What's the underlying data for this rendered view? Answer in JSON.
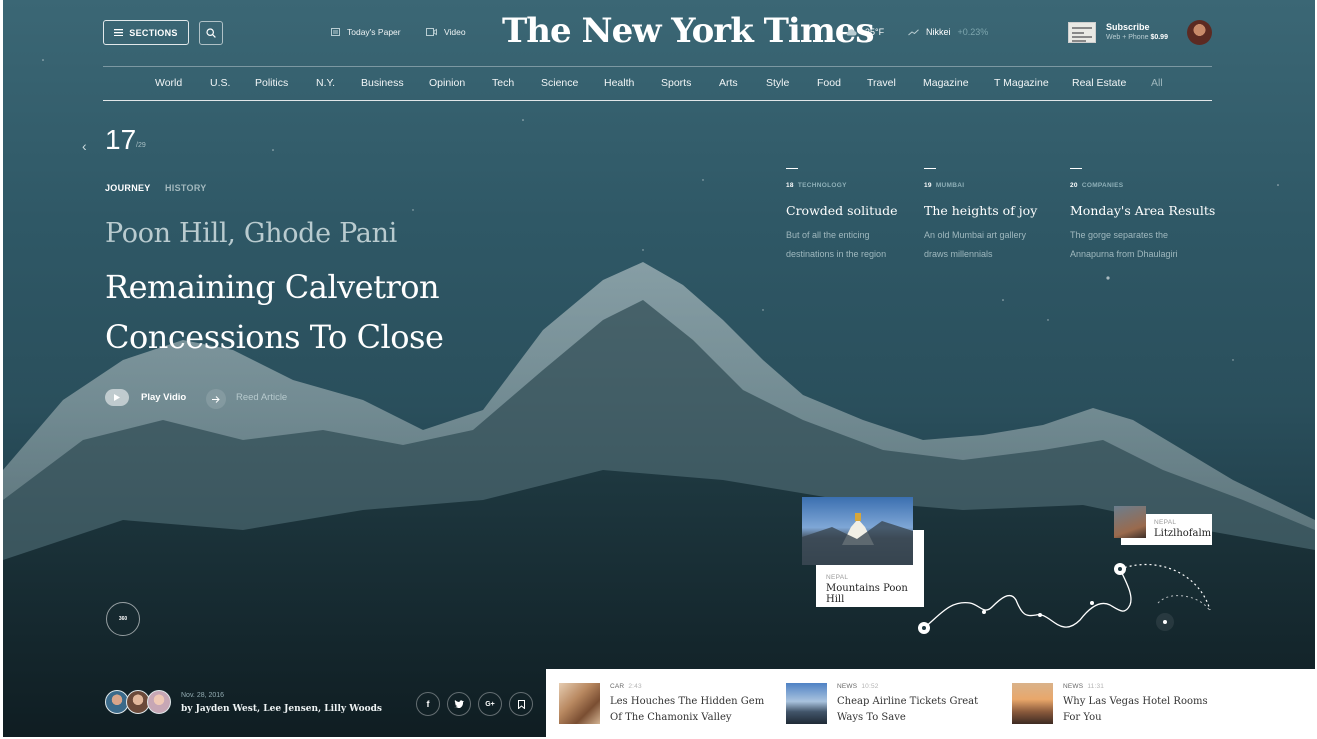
{
  "header": {
    "sections_label": "SECTIONS",
    "todays_paper_label": "Today's Paper",
    "video_label": "Video",
    "logo_text": "The New York Times",
    "weather": "25°F",
    "market_name": "Nikkei",
    "market_change": "+0.23%",
    "subscribe_label": "Subscribe",
    "subscribe_prefix": "Web + Phone",
    "subscribe_price": "$0.99"
  },
  "nav": {
    "items": [
      "World",
      "U.S.",
      "Politics",
      "N.Y.",
      "Business",
      "Opinion",
      "Tech",
      "Science",
      "Health",
      "Sports",
      "Arts",
      "Style",
      "Food",
      "Travel",
      "Magazine",
      "T Magazine",
      "Real Estate",
      "All"
    ]
  },
  "hero": {
    "count": "17",
    "count_total": "/29",
    "tag_active": "JOURNEY",
    "tag_inactive": "HISTORY",
    "kicker": "Poon Hill, Ghode Pani",
    "headline_line1": "Remaining Calvetron",
    "headline_line2": "Concessions To Close",
    "play_label": "Play Vidio",
    "read_label": "Reed Article"
  },
  "stories": [
    {
      "num": "18",
      "category": "TECHNOLOGY",
      "title": "Crowded solitude",
      "desc_line1": "But of all the enticing",
      "desc_line2": "destinations in the region"
    },
    {
      "num": "19",
      "category": "MUMBAI",
      "title": "The heights of joy",
      "desc_line1": "An old Mumbai art gallery",
      "desc_line2": "draws millennials"
    },
    {
      "num": "20",
      "category": "COMPANIES",
      "title": "Monday's Area Results",
      "desc_line1": "The gorge separates the",
      "desc_line2": "Annapurna from Dhaulagiri"
    }
  ],
  "pins": [
    {
      "category": "NEPAL",
      "name": "Mountains Poon Hill"
    },
    {
      "category": "NEPAL",
      "name": "Litzlhofalm"
    }
  ],
  "byline": {
    "badge_360": "360",
    "date": "Nov. 28, 2016",
    "authors": "by Jayden West, Lee Jensen, Lilly Woods"
  },
  "social": [
    "f",
    "t",
    "G+",
    "bookmark"
  ],
  "news": [
    {
      "category": "CAR",
      "time": "2:43",
      "title": "Les Houches The Hidden Gem Of The Chamonix Valley"
    },
    {
      "category": "NEWS",
      "time": "10:52",
      "title": "Cheap Airline Tickets Great Ways To Save"
    },
    {
      "category": "NEWS",
      "time": "11:31",
      "title": "Why Las Vegas Hotel Rooms For You"
    }
  ],
  "icons": {
    "sections": "hamburger-icon",
    "search": "search-icon",
    "paper": "newspaper-icon",
    "video": "video-icon",
    "weather": "cloud-icon",
    "market": "trend-icon",
    "play": "play-icon",
    "read": "arrow-right-icon",
    "prev": "chevron-left-icon"
  }
}
